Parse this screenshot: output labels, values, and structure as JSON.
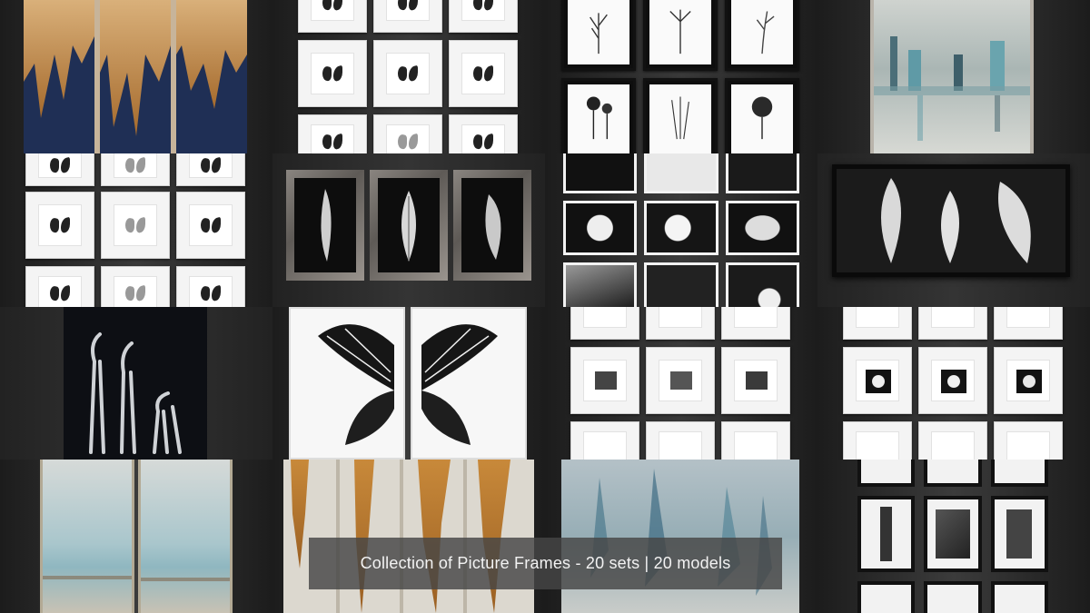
{
  "caption": {
    "text": "Collection of Picture Frames - 20 sets | 20 models"
  },
  "tiles": [
    {
      "name": "gold-navy-abstract-triptych"
    },
    {
      "name": "butterfly-white-frames-grid"
    },
    {
      "name": "botanical-bw-frames-grid"
    },
    {
      "name": "teal-abstract-cityscape-canvas"
    },
    {
      "name": "butterfly-specimen-grid"
    },
    {
      "name": "silver-feather-triptych"
    },
    {
      "name": "bw-flower-photo-grid"
    },
    {
      "name": "silver-leaves-shadowbox"
    },
    {
      "name": "silver-elephant-sculpture"
    },
    {
      "name": "large-butterfly-wings-diptych"
    },
    {
      "name": "city-bw-photo-grid"
    },
    {
      "name": "flower-white-frames-grid"
    },
    {
      "name": "seascape-diptych"
    },
    {
      "name": "gold-stroke-panels"
    },
    {
      "name": "blue-abstract-canvas"
    },
    {
      "name": "city-landmark-photo-grid"
    }
  ],
  "colors": {
    "background": "#2a2a2a",
    "navy": "#1f2f55",
    "gold": "#c8893a",
    "teal": "#5f9aa6"
  }
}
